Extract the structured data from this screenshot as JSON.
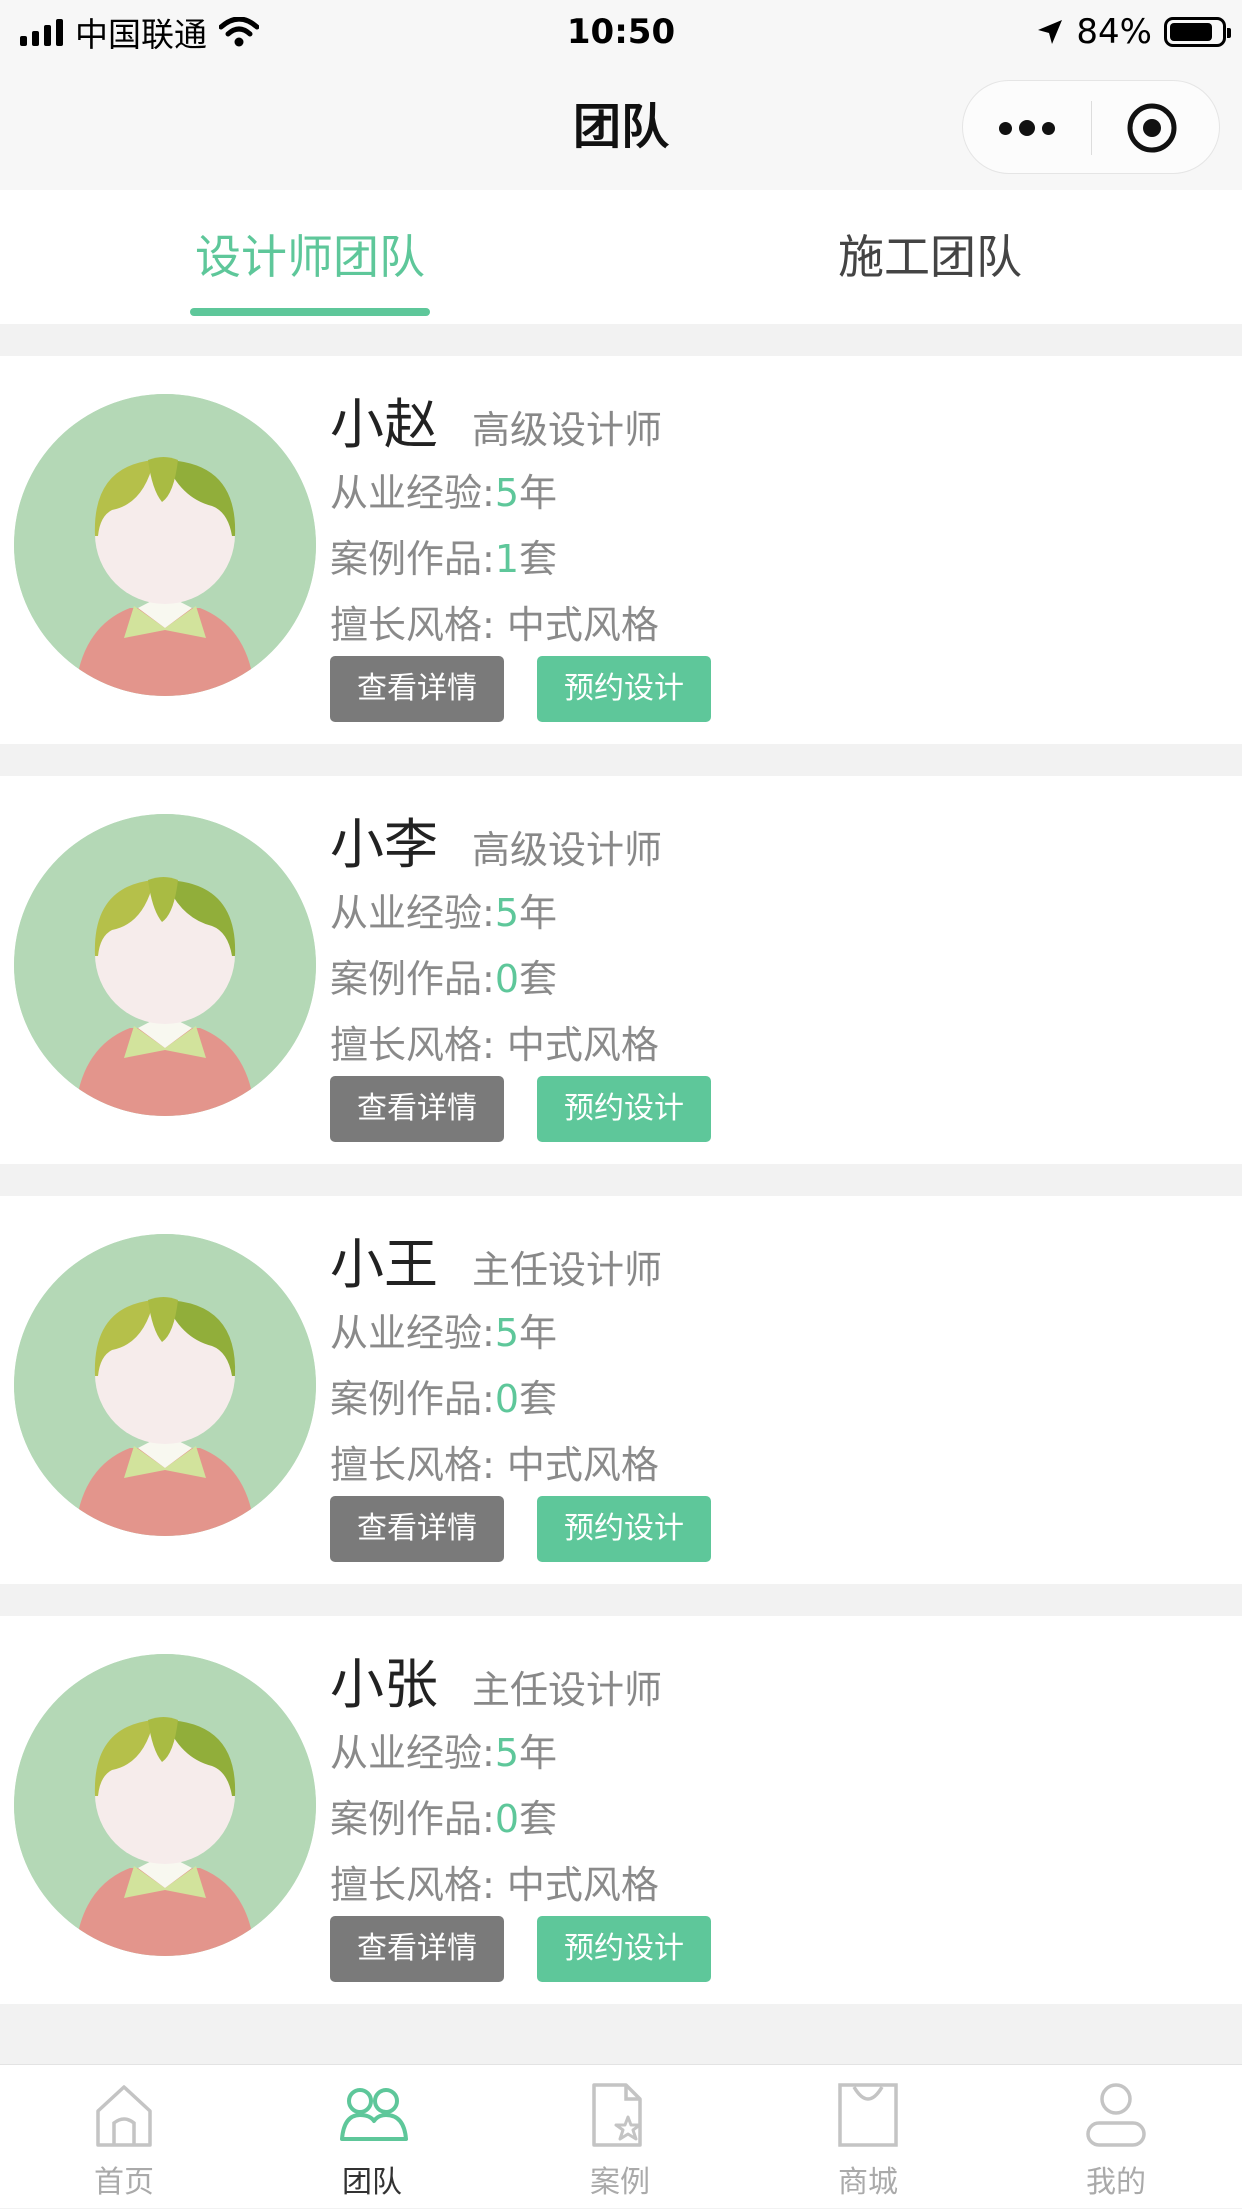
{
  "status_bar": {
    "carrier": "中国联通",
    "time": "10:50",
    "battery": "84%",
    "battery_level": 0.84
  },
  "nav": {
    "title": "团队"
  },
  "tabs": [
    {
      "label": "设计师团队",
      "active": true
    },
    {
      "label": "施工团队",
      "active": false
    }
  ],
  "designers": [
    {
      "name": "小赵",
      "title": "高级设计师",
      "experience_label": "从业经验:",
      "experience_value": "5",
      "experience_unit": "年",
      "cases_label": "案例作品:",
      "cases_value": "1",
      "cases_unit": "套",
      "style_label": "擅长风格:",
      "style_value": "中式风格",
      "detail_btn": "查看详情",
      "book_btn": "预约设计"
    },
    {
      "name": "小李",
      "title": "高级设计师",
      "experience_label": "从业经验:",
      "experience_value": "5",
      "experience_unit": "年",
      "cases_label": "案例作品:",
      "cases_value": "0",
      "cases_unit": "套",
      "style_label": "擅长风格:",
      "style_value": "中式风格",
      "detail_btn": "查看详情",
      "book_btn": "预约设计"
    },
    {
      "name": "小王",
      "title": "主任设计师",
      "experience_label": "从业经验:",
      "experience_value": "5",
      "experience_unit": "年",
      "cases_label": "案例作品:",
      "cases_value": "0",
      "cases_unit": "套",
      "style_label": "擅长风格:",
      "style_value": "中式风格",
      "detail_btn": "查看详情",
      "book_btn": "预约设计"
    },
    {
      "name": "小张",
      "title": "主任设计师",
      "experience_label": "从业经验:",
      "experience_value": "5",
      "experience_unit": "年",
      "cases_label": "案例作品:",
      "cases_value": "0",
      "cases_unit": "套",
      "style_label": "擅长风格:",
      "style_value": "中式风格",
      "detail_btn": "查看详情",
      "book_btn": "预约设计"
    }
  ],
  "tabbar": [
    {
      "label": "首页",
      "icon": "home-icon",
      "active": false
    },
    {
      "label": "团队",
      "icon": "team-icon",
      "active": true
    },
    {
      "label": "案例",
      "icon": "case-icon",
      "active": false
    },
    {
      "label": "商城",
      "icon": "shop-bag-icon",
      "active": false
    },
    {
      "label": "我的",
      "icon": "profile-icon",
      "active": false
    }
  ],
  "colors": {
    "accent": "#5ec79a",
    "detail_button": "#7a7a7a",
    "page_background": "#f2f2f2"
  }
}
